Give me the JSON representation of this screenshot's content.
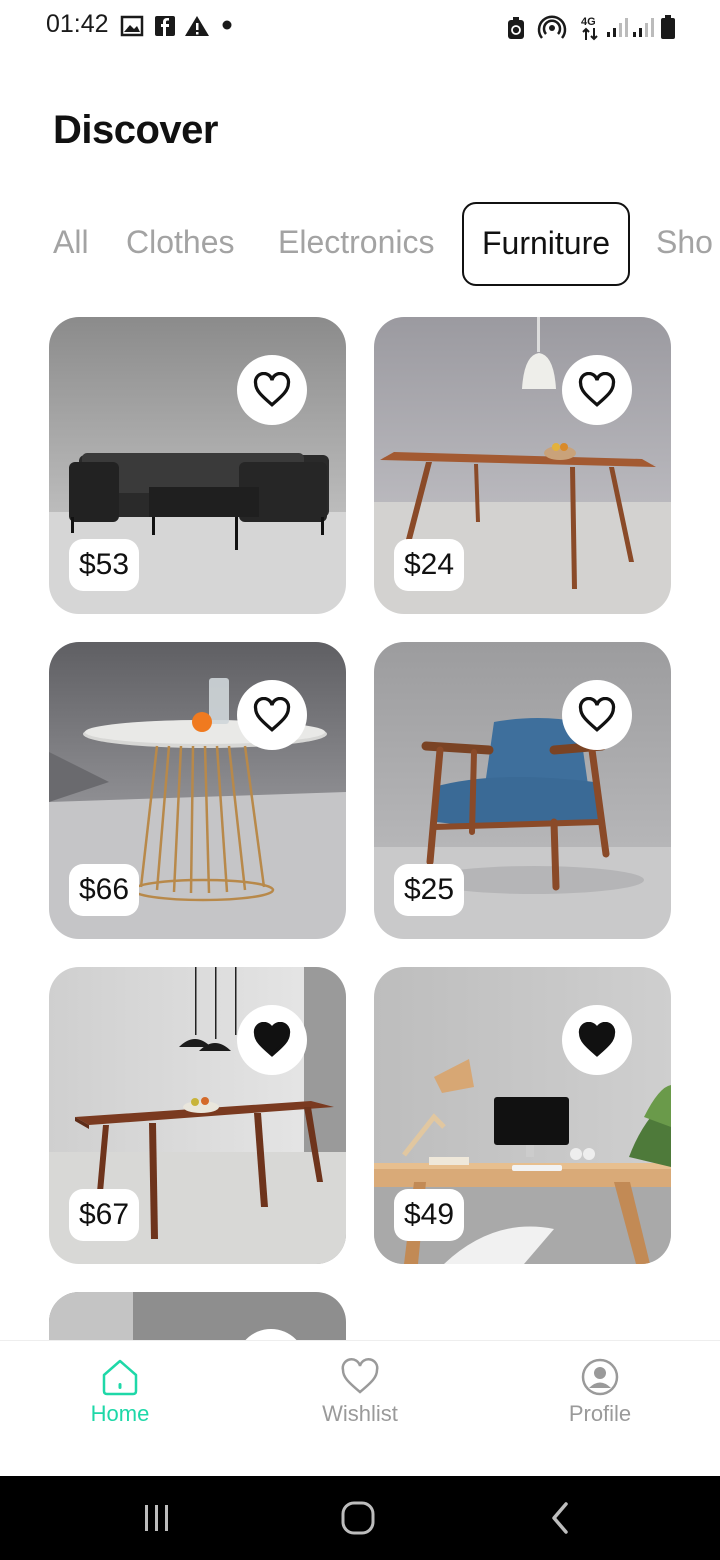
{
  "status_bar": {
    "time": "01:42",
    "left_icons": [
      "gallery-icon",
      "facebook-icon",
      "alert-icon",
      "dot-icon"
    ],
    "right_icons": [
      "battery-saver-icon",
      "hotspot-icon",
      "4g-icon",
      "signal-icon",
      "signal-icon",
      "battery-icon"
    ],
    "network_label": "4G"
  },
  "page": {
    "title": "Discover"
  },
  "categories": {
    "selected": "Furniture",
    "items": [
      {
        "label": "All"
      },
      {
        "label": "Clothes"
      },
      {
        "label": "Electronics"
      },
      {
        "label": "Furniture"
      },
      {
        "label": "Sho"
      }
    ]
  },
  "products": [
    {
      "price": "$53",
      "favorited": false,
      "kind": "sofa"
    },
    {
      "price": "$24",
      "favorited": false,
      "kind": "dining-table"
    },
    {
      "price": "$66",
      "favorited": false,
      "kind": "round-table"
    },
    {
      "price": "$25",
      "favorited": false,
      "kind": "armchair"
    },
    {
      "price": "$67",
      "favorited": true,
      "kind": "wooden-table"
    },
    {
      "price": "$49",
      "favorited": true,
      "kind": "desk"
    }
  ],
  "bottom_nav": {
    "active": "Home",
    "items": [
      {
        "label": "Home",
        "icon": "home-icon"
      },
      {
        "label": "Wishlist",
        "icon": "heart-icon"
      },
      {
        "label": "Profile",
        "icon": "profile-icon"
      }
    ]
  },
  "colors": {
    "accent": "#1ed8a8",
    "inactive": "#9a9a9a",
    "heart_filled": "#111111"
  },
  "system_nav": {
    "icons": [
      "recents-icon",
      "home-circle-icon",
      "back-icon"
    ]
  }
}
